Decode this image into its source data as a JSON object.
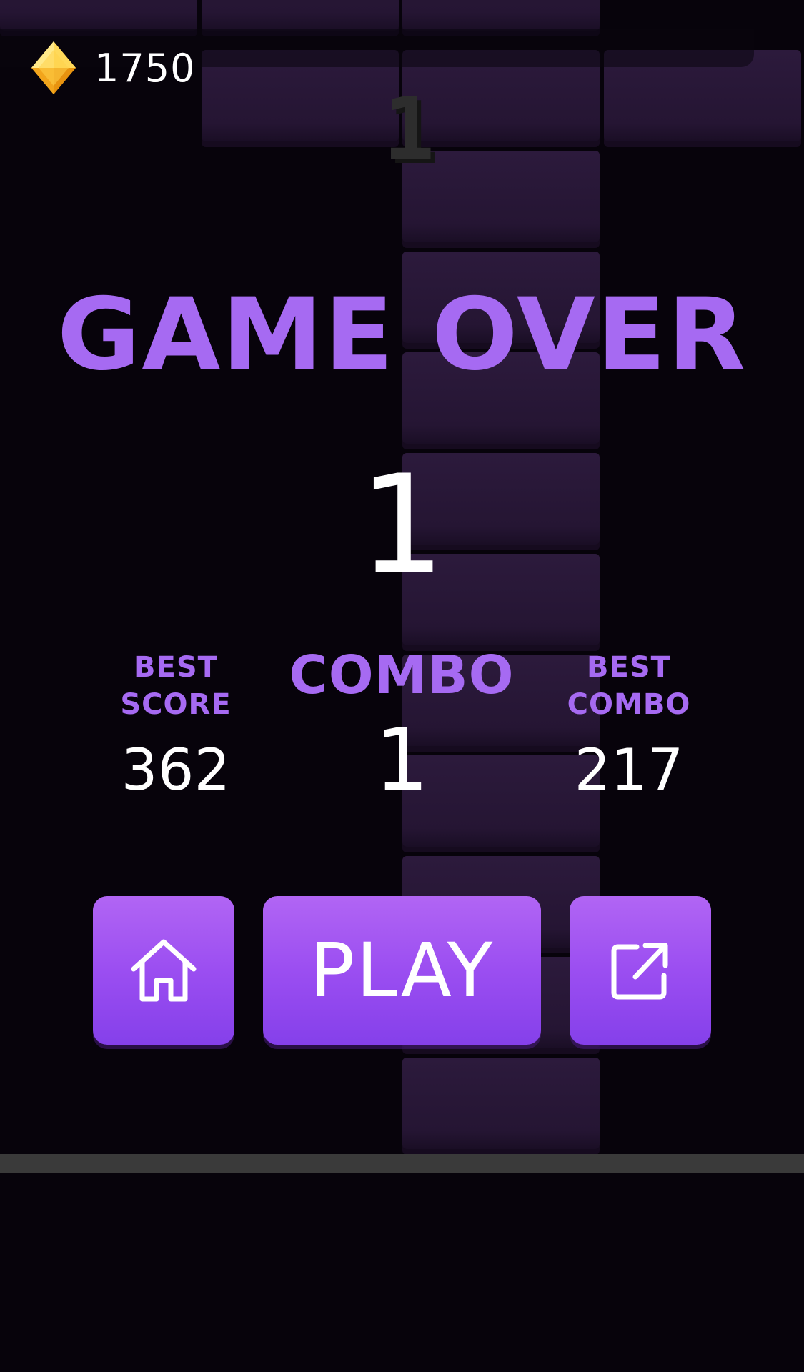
{
  "hud": {
    "gem_count": "1750",
    "ghost_score": "1"
  },
  "game_over": {
    "title": "GAME OVER",
    "score": "1",
    "best_score": {
      "label_line1": "BEST",
      "label_line2": "SCORE",
      "value": "362"
    },
    "combo": {
      "label": "COMBO",
      "value": "1"
    },
    "best_combo": {
      "label_line1": "BEST",
      "label_line2": "COMBO",
      "value": "217"
    }
  },
  "buttons": {
    "home_icon": "home-icon",
    "play_label": "PLAY",
    "share_icon": "share-icon"
  },
  "colors": {
    "accent_purple": "#a66af2",
    "button_gradient_top": "#b165f4",
    "button_gradient_bottom": "#8540ea",
    "gem_gold": "#f7c33a",
    "background": "#07030b",
    "tile": "#2a1839"
  }
}
